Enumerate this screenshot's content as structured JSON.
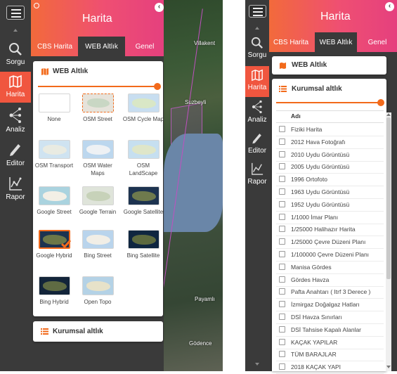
{
  "left": {
    "header": {
      "title": "Harita"
    },
    "tabs": [
      {
        "label": "CBS Harita"
      },
      {
        "label": "WEB Altlık"
      },
      {
        "label": "Genel"
      }
    ],
    "rail": [
      {
        "label": "Sorgu",
        "icon": "search-icon"
      },
      {
        "label": "Harita",
        "icon": "map-icon"
      },
      {
        "label": "Analiz",
        "icon": "network-icon"
      },
      {
        "label": "Editor",
        "icon": "pencil-icon"
      },
      {
        "label": "Rapor",
        "icon": "chart-icon"
      }
    ],
    "web_card": {
      "title": "WEB Altlık",
      "opacity_fraction": 1.0
    },
    "basemaps": [
      {
        "label": "None"
      },
      {
        "label": "OSM Street"
      },
      {
        "label": "OSM Cycle Map"
      },
      {
        "label": "OSM Transport"
      },
      {
        "label": "OSM Water Maps"
      },
      {
        "label": "OSM LandScape"
      },
      {
        "label": "Google Street"
      },
      {
        "label": "Google Terrain"
      },
      {
        "label": "Google Satellite"
      },
      {
        "label": "Google Hybrid"
      },
      {
        "label": "Bing Street"
      },
      {
        "label": "Bing Satellite"
      },
      {
        "label": "Bing Hybrid"
      },
      {
        "label": "Open Topo"
      }
    ],
    "selected_basemap": "Google Hybrid",
    "kurumsal_card": {
      "title": "Kurumsal altlık"
    },
    "map_labels": {
      "villakent": "Villakent",
      "suzbeyli": "Suzbeyli",
      "payamli": "Payamlı",
      "godence": "Gödence"
    }
  },
  "right": {
    "header": {
      "title": "Harita"
    },
    "tabs": [
      {
        "label": "CBS Harita"
      },
      {
        "label": "WEB Altlık"
      },
      {
        "label": "Genel"
      }
    ],
    "rail": [
      {
        "label": "Sorgu"
      },
      {
        "label": "Harita"
      },
      {
        "label": "Analiz"
      },
      {
        "label": "Editor"
      },
      {
        "label": "Rapor"
      }
    ],
    "web_card": {
      "title": "WEB Altlık"
    },
    "kurumsal_card": {
      "title": "Kurumsal altlık",
      "opacity_fraction": 1.0
    },
    "table_header": "Adı",
    "layers": [
      "Fiziki Harita",
      "2012 Hava Fotoğrafı",
      "2010 Uydu Görüntüsü",
      "2005 Uydu Görüntüsü",
      "1996 Ortofoto",
      "1963 Uydu Görüntüsü",
      "1952 Uydu Görüntüsü",
      "1/1000 İmar Planı",
      "1/25000 Halihazır Harita",
      "1/25000 Çevre Düzeni Planı",
      "1/100000 Çevre Düzeni Planı",
      "Manisa Gördes",
      "Gördes Havza",
      "Pafta Anahtarı ( Itrf 3 Derece )",
      "İzmirgaz Doğalgaz Hatları",
      "DSİ Havza Sınırları",
      "DSİ Tahsise Kapalı Alanlar",
      "KAÇAK YAPILAR",
      "TÜM BARAJLAR",
      "2018 KAÇAK YAPI"
    ]
  },
  "colors": {
    "accent": "#f26a1b",
    "header_from": "#f26a3b",
    "header_to": "#e5407e",
    "rail": "#3a3a3a",
    "active_rail": "#f0563f"
  }
}
